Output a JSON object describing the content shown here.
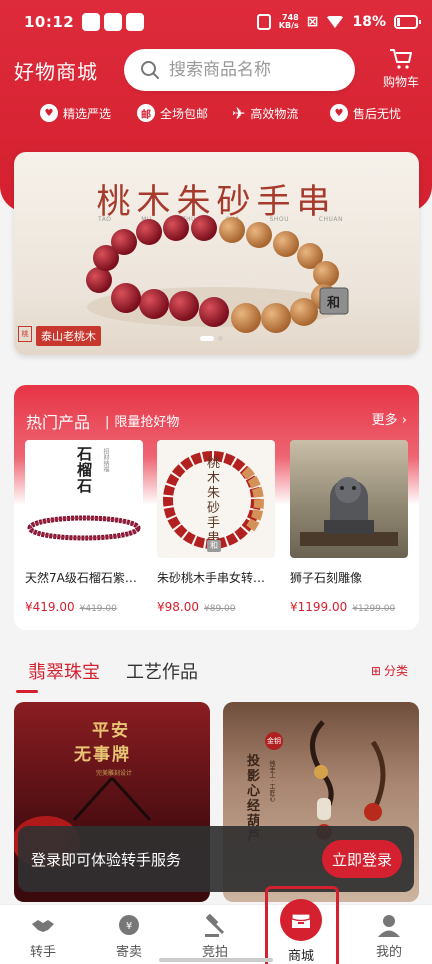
{
  "status_bar": {
    "time": "10:12",
    "network_speed_value": "748",
    "network_speed_unit": "KB/s",
    "battery": "18%"
  },
  "header": {
    "title": "好物商城",
    "search_placeholder": "搜索商品名称",
    "cart_label": "购物车"
  },
  "features": [
    {
      "label": "精选严选",
      "icon": "heart-icon"
    },
    {
      "label": "全场包邮",
      "icon": "free-shipping-icon"
    },
    {
      "label": "高效物流",
      "icon": "airplane-icon"
    },
    {
      "label": "售后无忧",
      "icon": "shield-heart-icon"
    }
  ],
  "banner": {
    "title": "桃木朱砂手串",
    "pinyin": [
      "TAO",
      "MU",
      "ZHU",
      "SHA",
      "SHOU",
      "CHUAN"
    ],
    "brand": "泰山老桃木",
    "seal": "桃",
    "bead_tag": "和"
  },
  "hot_products": {
    "title": "热门产品",
    "subtitle": "限量抢好物",
    "more_label": "更多",
    "items": [
      {
        "name": "天然7A级石榴石紫…",
        "price": "¥419.00",
        "original_price": "¥419.00",
        "img_text": "石榴石",
        "img_caption": "招财纳福"
      },
      {
        "name": "朱砂桃木手串女转…",
        "price": "¥98.00",
        "original_price": "¥89.00",
        "img_text": "桃木朱砂手串",
        "img_caption": "和"
      },
      {
        "name": "狮子石刻雕像",
        "price": "¥1199.00",
        "original_price": "¥1299.00"
      }
    ]
  },
  "categories": {
    "tabs": [
      "翡翠珠宝",
      "工艺作品"
    ],
    "classify_label": "分类"
  },
  "feed": [
    {
      "title_line1": "平安",
      "title_line2": "无事牌",
      "caption": "完美雕刻设计"
    },
    {
      "seal": "金钥",
      "title": "投影心经葫芦",
      "caption": "纯手工 · 工匠心"
    }
  ],
  "login_prompt": {
    "text": "登录即可体验转手服务",
    "button": "立即登录"
  },
  "tabbar": [
    {
      "label": "转手",
      "icon": "handshake-icon"
    },
    {
      "label": "寄卖",
      "icon": "consign-icon"
    },
    {
      "label": "竞拍",
      "icon": "gavel-icon"
    },
    {
      "label": "商城",
      "icon": "store-icon"
    },
    {
      "label": "我的",
      "icon": "person-icon"
    }
  ],
  "colors": {
    "accent": "#d4202f",
    "banner_title": "#a63a2c"
  }
}
